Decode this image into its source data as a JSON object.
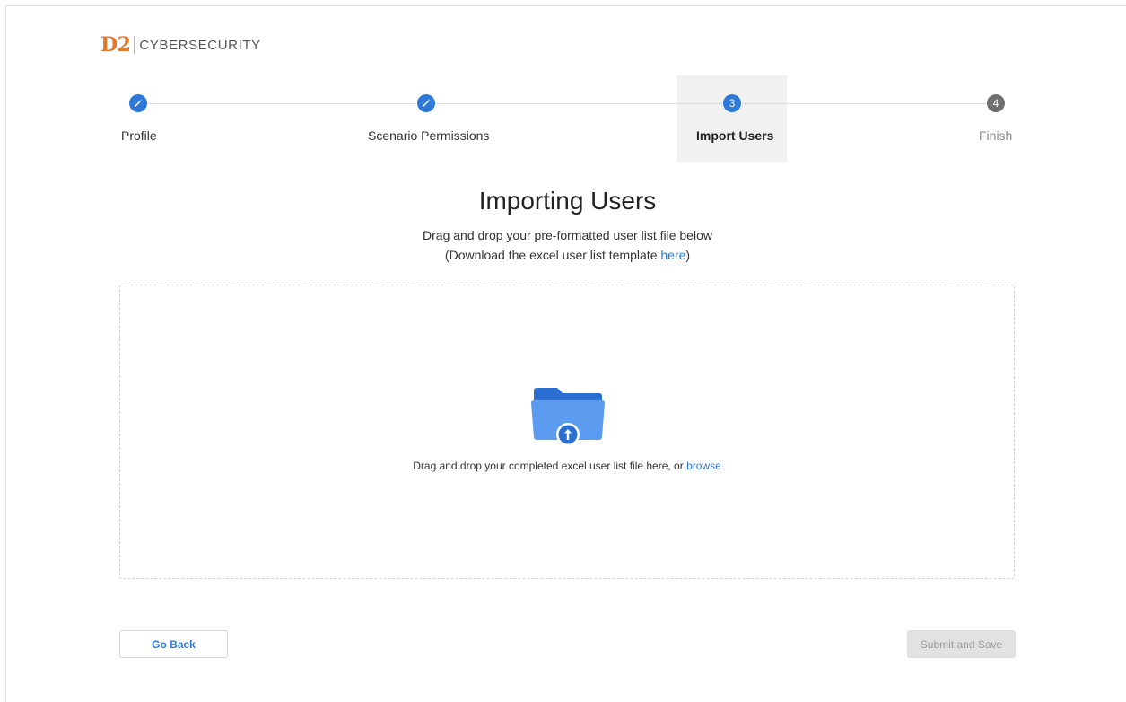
{
  "logo": {
    "mark": "D2",
    "text": "CYBERSECURITY",
    "brand_color": "#e8762b"
  },
  "stepper": {
    "steps": [
      {
        "label": "Profile",
        "state": "done",
        "icon": "pencil-icon"
      },
      {
        "label": "Scenario Permissions",
        "state": "done",
        "icon": "pencil-icon"
      },
      {
        "label": "Import Users",
        "state": "active",
        "number": "3"
      },
      {
        "label": "Finish",
        "state": "todo",
        "number": "4"
      }
    ]
  },
  "main": {
    "title": "Importing Users",
    "instruction": "Drag and drop your pre-formatted user list file below",
    "template_prefix": "(Download the excel user list template ",
    "template_link": "here",
    "template_suffix": ")"
  },
  "dropzone": {
    "icon": "folder-upload-icon",
    "text": "Drag and drop your completed excel user list file here, or ",
    "browse_link": "browse"
  },
  "footer": {
    "back_label": "Go Back",
    "submit_label": "Submit and Save"
  },
  "colors": {
    "accent": "#2d78d9",
    "step_todo": "#6f6f6f"
  }
}
